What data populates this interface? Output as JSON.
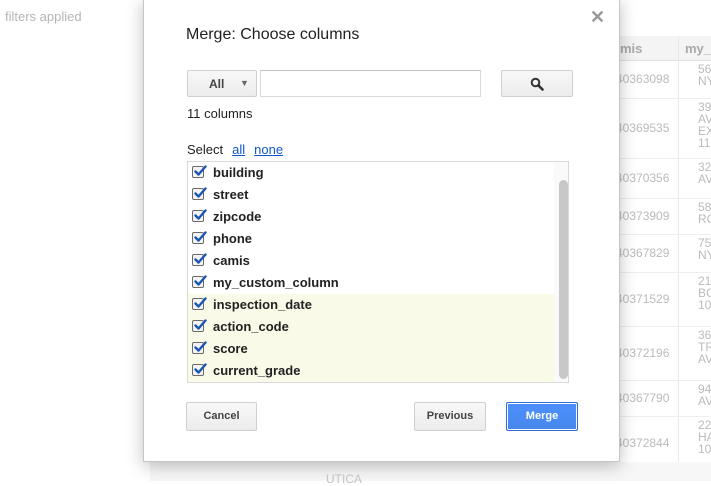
{
  "background": {
    "filters_text": "filters applied",
    "columns": [
      "mis",
      "my_"
    ],
    "rows": [
      {
        "camis": "40363098",
        "addr": "56\nNY"
      },
      {
        "camis": "40369535",
        "addr": "39\nAV\nEX\n11"
      },
      {
        "camis": "40370356",
        "addr": "32\nAV"
      },
      {
        "camis": "40373909",
        "addr": "58\nRC"
      },
      {
        "camis": "40367829",
        "addr": "75\nNY"
      },
      {
        "camis": "40371529",
        "addr": "21\nBC\n10"
      },
      {
        "camis": "40372196",
        "addr": "36\nTR\nAV"
      },
      {
        "camis": "40367790",
        "addr": "94\nAV"
      },
      {
        "camis": "40372844",
        "addr": "22\nHA\n10"
      }
    ],
    "bottom_text": "UTICA"
  },
  "dialog": {
    "title": "Merge: Choose columns",
    "close_glyph": "✕",
    "filter_select": {
      "value": "All",
      "caret": "▼"
    },
    "search_input": {
      "value": "",
      "placeholder": ""
    },
    "search_icon": "search-icon",
    "column_count": "11 columns",
    "select_label": "Select",
    "select_all": "all",
    "select_none": "none",
    "columns": [
      {
        "label": "building",
        "checked": true,
        "highlighted": false
      },
      {
        "label": "street",
        "checked": true,
        "highlighted": false
      },
      {
        "label": "zipcode",
        "checked": true,
        "highlighted": false
      },
      {
        "label": "phone",
        "checked": true,
        "highlighted": false
      },
      {
        "label": "camis",
        "checked": true,
        "highlighted": false
      },
      {
        "label": "my_custom_column",
        "checked": true,
        "highlighted": false
      },
      {
        "label": "inspection_date",
        "checked": true,
        "highlighted": true
      },
      {
        "label": "action_code",
        "checked": true,
        "highlighted": true
      },
      {
        "label": "score",
        "checked": true,
        "highlighted": true
      },
      {
        "label": "current_grade",
        "checked": true,
        "highlighted": true
      }
    ],
    "buttons": {
      "cancel": "Cancel",
      "previous": "Previous",
      "merge": "Merge"
    }
  },
  "colors": {
    "accent": "#4d90fe",
    "link": "#1155cc",
    "highlight_row": "#fafae8",
    "checkmark": "#1a56b0"
  }
}
